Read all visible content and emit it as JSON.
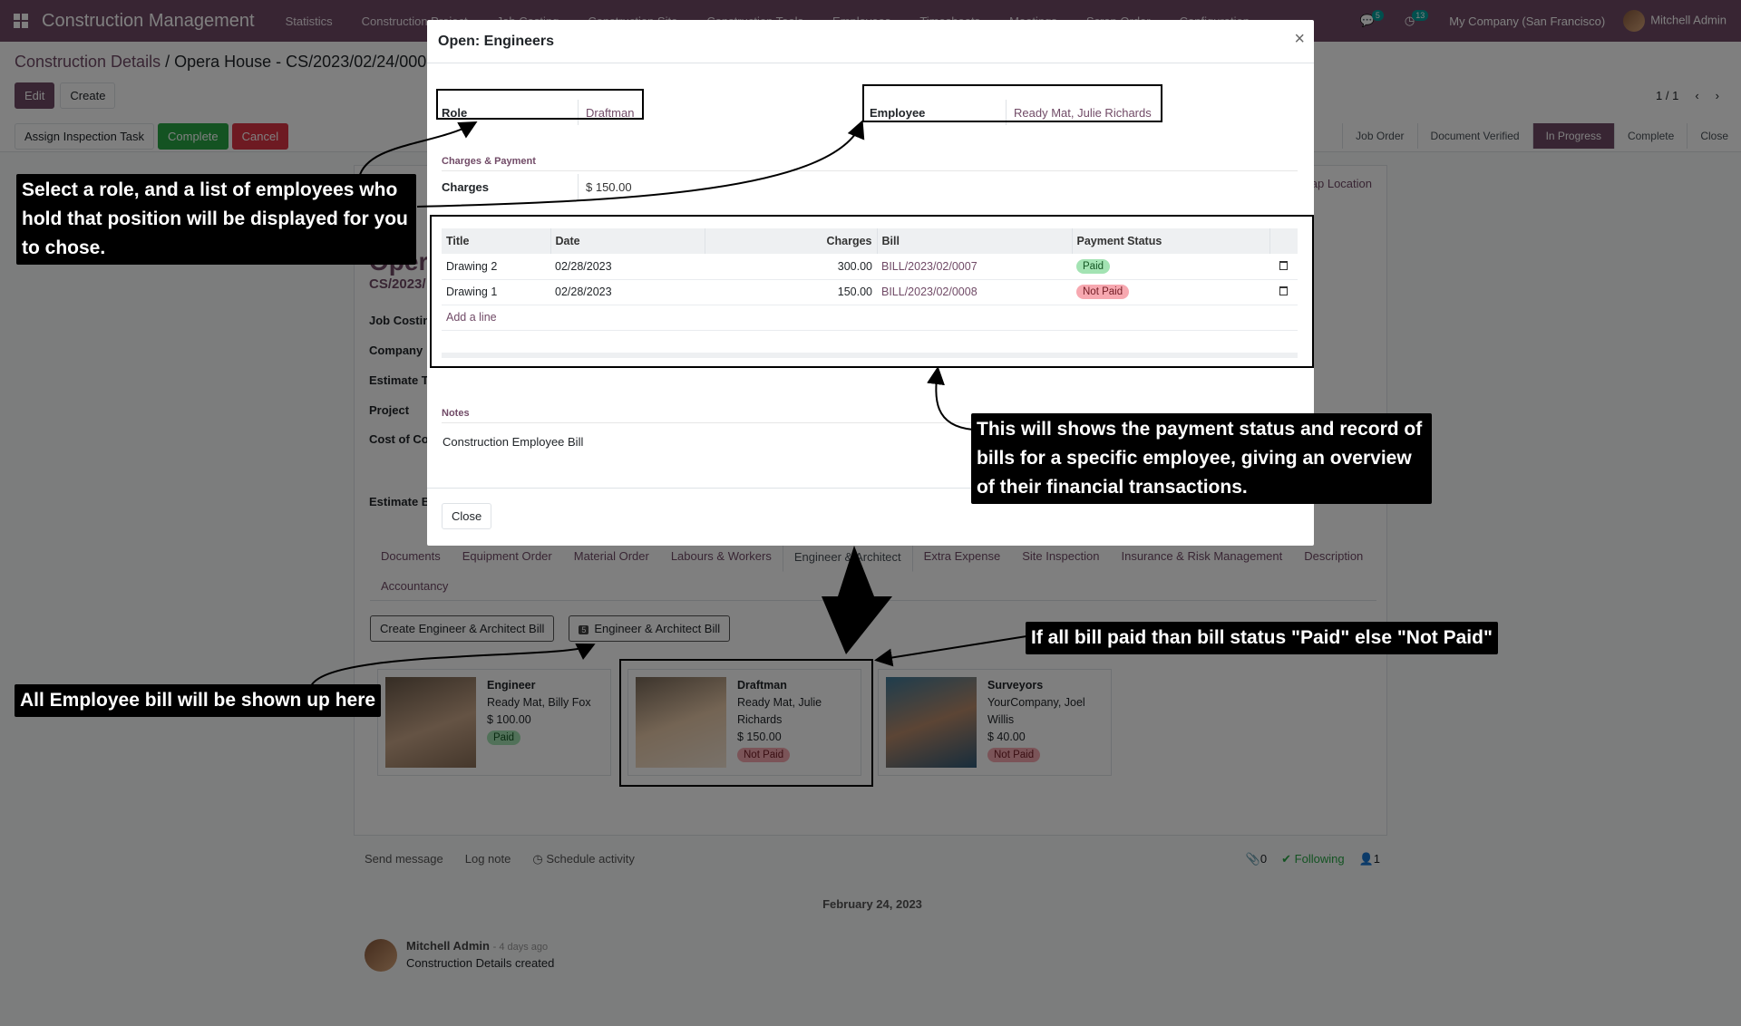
{
  "navbar": {
    "brand": "Construction Management",
    "menu": [
      "Statistics",
      "Construction Project",
      "Job Costing",
      "Construction Site",
      "Construction Tools",
      "Employees",
      "Timesheets",
      "Meetings",
      "Scrap Order",
      "Configuration"
    ],
    "messages_count": "5",
    "activities_count": "13",
    "company": "My Company (San Francisco)",
    "user": "Mitchell Admin"
  },
  "breadcrumb": {
    "parent": "Construction Details",
    "current": "Opera House - CS/2023/02/24/0006"
  },
  "actions": {
    "edit": "Edit",
    "create": "Create",
    "assign": "Assign Inspection Task",
    "complete": "Complete",
    "cancel": "Cancel"
  },
  "pager": "1 / 1",
  "stages": [
    "Job Order",
    "Document Verified",
    "In Progress",
    "Complete",
    "Close"
  ],
  "form": {
    "map_location": "Map Location",
    "title_partial": "Opera",
    "code_partial": "CS/2023/",
    "labels": [
      "Job Costing",
      "Company",
      "Estimate T",
      "Project",
      "Cost of Co",
      "Estimate B"
    ]
  },
  "tabs": [
    "Documents",
    "Equipment Order",
    "Material Order",
    "Labours & Workers",
    "Engineer & Architect",
    "Extra Expense",
    "Site Inspection",
    "Insurance & Risk Management",
    "Description",
    "Accountancy"
  ],
  "bill_buttons": {
    "create": "Create Engineer & Architect Bill",
    "count": "5",
    "view": "Engineer & Architect Bill"
  },
  "cards": [
    {
      "role": "Engineer",
      "name": "Ready Mat, Billy Fox",
      "amount": "$ 100.00",
      "status": "Paid"
    },
    {
      "role": "Draftman",
      "name": "Ready Mat, Julie Richards",
      "amount": "$ 150.00",
      "status": "Not Paid"
    },
    {
      "role": "Surveyors",
      "name": "YourCompany, Joel Willis",
      "amount": "$ 40.00",
      "status": "Not Paid"
    }
  ],
  "chatter": {
    "send": "Send message",
    "log": "Log note",
    "schedule": "Schedule activity",
    "attachments": "0",
    "following": "Following",
    "followers": "1",
    "date": "February 24, 2023",
    "author": "Mitchell Admin",
    "ago": "- 4 days ago",
    "message": "Construction Details created"
  },
  "modal": {
    "title": "Open: Engineers",
    "role_label": "Role",
    "role_value": "Draftman",
    "employee_label": "Employee",
    "employee_value": "Ready Mat, Julie Richards",
    "section": "Charges & Payment",
    "charges_label": "Charges",
    "charges_value": "$ 150.00",
    "table_headers": [
      "Title",
      "Date",
      "Charges",
      "Bill",
      "Payment Status"
    ],
    "rows": [
      {
        "title": "Drawing 2",
        "date": "02/28/2023",
        "charges": "300.00",
        "bill": "BILL/2023/02/0007",
        "status": "Paid"
      },
      {
        "title": "Drawing 1",
        "date": "02/28/2023",
        "charges": "150.00",
        "bill": "BILL/2023/02/0008",
        "status": "Not Paid"
      }
    ],
    "add_line": "Add a line",
    "notes_title": "Notes",
    "notes": "Construction Employee Bill",
    "close": "Close"
  },
  "annotations": {
    "role_tip": "Select a role, and a list of employees who hold  that position will be displayed for you to chose.",
    "table_tip": "This will shows the payment status and record of bills for a specific employee, giving an overview of their financial transactions.",
    "status_tip": "If all bill paid than bill status \"Paid\" else \"Not Paid\"",
    "bills_tip": "All Employee bill will be shown up here"
  }
}
